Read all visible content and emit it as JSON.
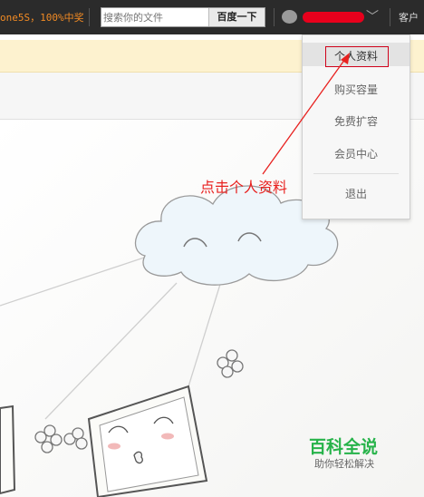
{
  "topbar": {
    "promo_text": "one5S，100%中奖",
    "search_placeholder": "搜索你的文件",
    "search_button": "百度一下",
    "help_link": "客户"
  },
  "dropdown": {
    "items": [
      {
        "label": "个人资料"
      },
      {
        "label": "购买容量"
      },
      {
        "label": "免费扩容"
      },
      {
        "label": "会员中心"
      },
      {
        "label": "退出"
      }
    ]
  },
  "annotation": {
    "text": "点击个人资料",
    "color": "#e8211f"
  },
  "watermark": {
    "title": "百科全说",
    "subtitle": "助你轻松解决",
    "color": "#27b34a"
  },
  "icons": {
    "user_avatar": "avatar-icon",
    "menu_toggle": "chevron-down-icon"
  }
}
